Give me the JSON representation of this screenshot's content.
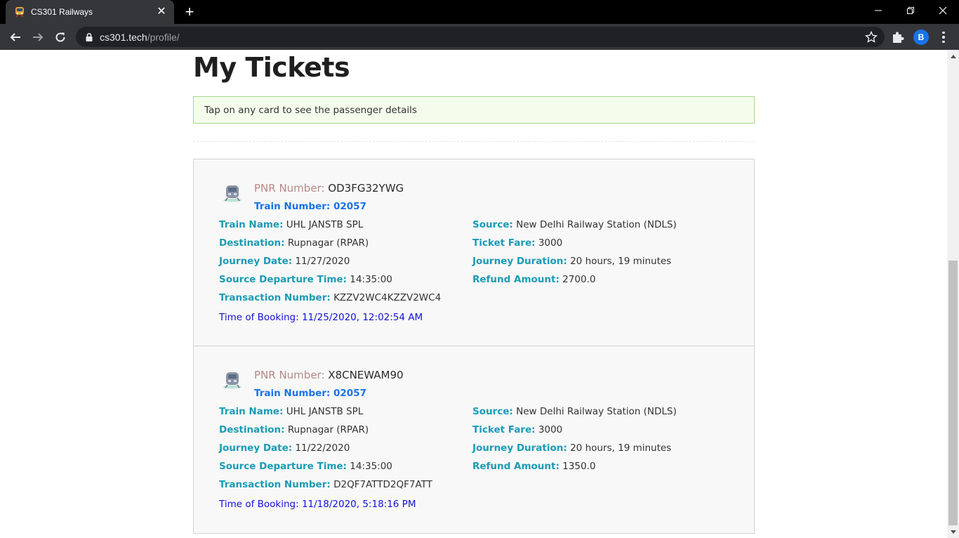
{
  "browser": {
    "tab_title": "CS301 Railways",
    "url_host": "cs301.tech",
    "url_path": "/profile/",
    "profile_initial": "B"
  },
  "page": {
    "title": "My Tickets",
    "alert": "Tap on any card to see the passenger details"
  },
  "labels": {
    "pnr": "PNR Number:",
    "train_number": "Train Number:",
    "train_name": "Train Name:",
    "destination": "Destination:",
    "journey_date": "Journey Date:",
    "source_departure": "Source Departure Time:",
    "transaction": "Transaction Number:",
    "source": "Source:",
    "ticket_fare": "Ticket Fare:",
    "journey_duration": "Journey Duration:",
    "refund": "Refund Amount:",
    "time_of_booking": "Time of Booking:"
  },
  "tickets": [
    {
      "pnr": "OD3FG32YWG",
      "train_number": "02057",
      "train_name": "UHL JANSTB SPL",
      "destination": "Rupnagar (RPAR)",
      "journey_date": "11/27/2020",
      "source_departure": "14:35:00",
      "transaction": "KZZV2WC4KZZV2WC4",
      "source": "New Delhi Railway Station (NDLS)",
      "ticket_fare": "3000",
      "journey_duration": "20 hours, 19 minutes",
      "refund": "2700.0",
      "time_of_booking": "11/25/2020, 12:02:54 AM"
    },
    {
      "pnr": "X8CNEWAM90",
      "train_number": "02057",
      "train_name": "UHL JANSTB SPL",
      "destination": "Rupnagar (RPAR)",
      "journey_date": "11/22/2020",
      "source_departure": "14:35:00",
      "transaction": "D2QF7ATTD2QF7ATT",
      "source": "New Delhi Railway Station (NDLS)",
      "ticket_fare": "3000",
      "journey_duration": "20 hours, 19 minutes",
      "refund": "1350.0",
      "time_of_booking": "11/18/2020, 5:18:16 PM"
    }
  ]
}
